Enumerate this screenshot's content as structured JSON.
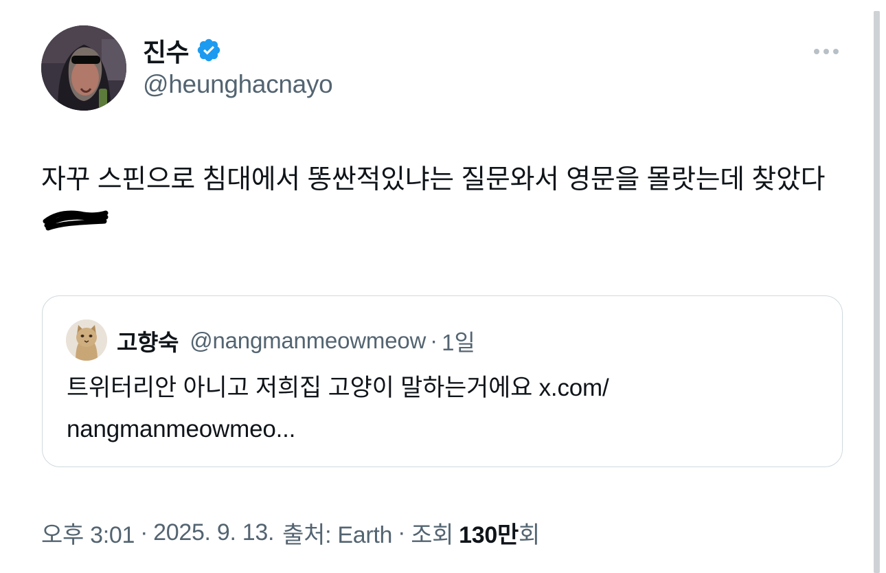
{
  "tweet": {
    "display_name": "진수",
    "handle": "@heunghacnayo",
    "verified": true,
    "text": "자꾸 스핀으로 침대에서 똥싼적있냐는 질문와서 영문을 몰랏는데 찾았다",
    "accent_color": "#1d9bf0"
  },
  "quote": {
    "display_name": "고향숙",
    "handle": "@nangmanmeowmeow",
    "separator": "·",
    "time": "1일",
    "text": "트위터리안 아니고 저희집 고양이 말하는거에요 x.com/ nangmanmeowmeo..."
  },
  "meta": {
    "time": "오후 3:01",
    "date": "2025. 9. 13.",
    "source": "출처: Earth",
    "views_prefix": "조회",
    "views_count": "130만",
    "views_suffix": "회",
    "separator": "·"
  },
  "icons": {
    "more": "more-horizontal-icon",
    "verified": "verified-badge-icon"
  }
}
